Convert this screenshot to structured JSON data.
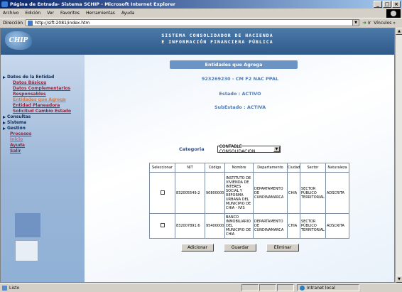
{
  "window": {
    "title": "Página de Entrada- Sistema SCHIP - Microsoft Internet Explorer"
  },
  "menu": [
    "Archivo",
    "Edición",
    "Ver",
    "Favoritos",
    "Herramientas",
    "Ayuda"
  ],
  "address": {
    "label": "Dirección",
    "url": "http://sift:2081/index.htm",
    "go": "Ir",
    "links": "Vínculos »"
  },
  "header": {
    "logo": "CHIP",
    "title_line1": "SISTEMA CONSOLIDADOR DE HACIENDA",
    "title_line2": "E INFORMACIÓN FINANCIERA PÚBLICA"
  },
  "nav": {
    "section_entidad": "Datos de la Entidad",
    "sub_items": [
      "Datos Básicos",
      "Datos Complementarios",
      "Responsables",
      "Entidades que Agrega",
      "Entidad Planeadora",
      "Solicitud Cambio Estado"
    ],
    "consultas": "Consultas",
    "sistema": "Sistema",
    "gestion": "Gestión",
    "procesos": "Procesos",
    "inicio": "Inicio",
    "ayuda": "Ayuda",
    "salir": "Salir"
  },
  "main": {
    "section_title": "Entidades que Agrega",
    "entity_line": "923269230 - CM F2 NAC PPAL",
    "estado": "Estado : ACTIVO",
    "subestado": "SubEstado : ACTIVA",
    "categoria_label": "Categoria",
    "categoria_value": "CONTABLE CONSOLIDACION"
  },
  "table": {
    "headers": [
      "Seleccionar",
      "NIT",
      "Código",
      "Nombre",
      "Departamento",
      "Ciudad",
      "Sector",
      "Naturaleza"
    ],
    "rows": [
      {
        "nit": "832005549:2",
        "codigo": "90800000",
        "nombre": "INSTITUTO DE VIVIENDA DE INTERES SOCIAL Y REFORMA URBANA DEL MUNICIPIO DE CHIA - IVIS",
        "departamento": "DEPARTAMENTO DE CUNDINAMARCA",
        "ciudad": "CHIA",
        "sector": "SECTOR PÚBLICO TERRITORIAL",
        "naturaleza": "ADSCRITA"
      },
      {
        "nit": "832007891:6",
        "codigo": "95400000",
        "nombre": "BANCO INMOBILIARIO DEL MUNICIPIO DE CHIA",
        "departamento": "DEPARTAMENTO DE CUNDINAMARCA",
        "ciudad": "CHIA",
        "sector": "SECTOR PÚBLICO TERRITORIAL",
        "naturaleza": "ADSCRITA"
      }
    ]
  },
  "buttons": {
    "adicionar": "Adicionar",
    "guardar": "Guardar",
    "eliminar": "Eliminar"
  },
  "status": {
    "left": "Listo",
    "zone": "Intranet local"
  },
  "colors": {
    "title_bar": "#0a246a",
    "section_title_bg": "#6b93c4",
    "info_text": "#4f7db5",
    "nav_link": "#a0223a"
  }
}
